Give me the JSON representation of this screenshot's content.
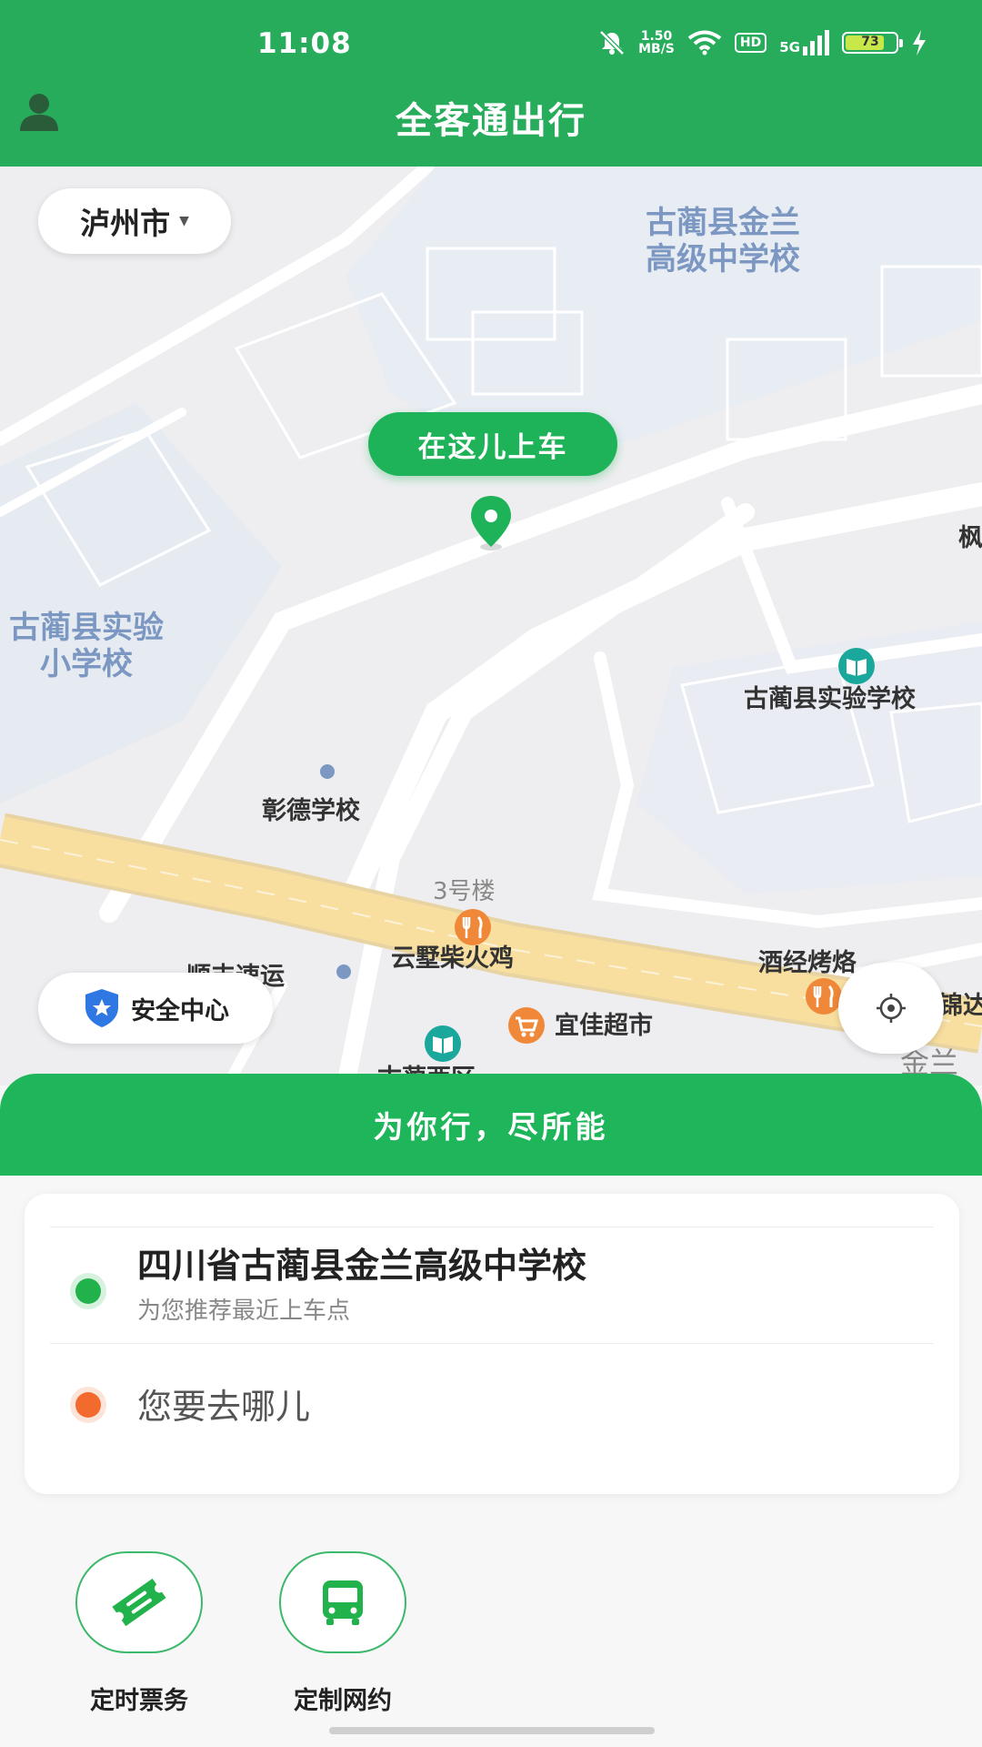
{
  "status_bar": {
    "time": "11:08",
    "speed_value": "1.50",
    "speed_unit": "MB/S",
    "hd_label": "HD",
    "network_label": "5G",
    "battery_level": "73",
    "icons": [
      "mute-icon",
      "wifi-icon",
      "signal-icon",
      "battery-icon",
      "charging-icon"
    ]
  },
  "header": {
    "title": "全客通出行",
    "profile_icon": "person-icon"
  },
  "city_selector": {
    "city": "泸州市"
  },
  "map": {
    "pickup_tag": "在这儿上车",
    "labels": {
      "school_top_line1": "古蔺县金兰",
      "school_top_line2": "高级中学校",
      "primary_line1": "古蔺县实验",
      "primary_line2": "小学校",
      "experimental_school": "古蔺县实验学校",
      "zhangde": "彰德学校",
      "building3": "3号楼",
      "yunshu": "云墅柴火鸡",
      "jiujing": "酒经烤烙",
      "shunda": "顺丰速运",
      "yijia": "宜佳超市",
      "gulan_west": "古蔺西区",
      "edge_right_top": "枫",
      "edge_right_mid": "锦达",
      "road_right": "金兰"
    }
  },
  "safety_center": {
    "label": "安全中心"
  },
  "slogan": "为你行，尽所能",
  "trip": {
    "from_title": "四川省古蔺县金兰高级中学校",
    "from_subtitle": "为您推荐最近上车点",
    "to_placeholder": "您要去哪儿",
    "from_color": "#22b24c",
    "to_color": "#f26a2e"
  },
  "services": [
    {
      "label": "定时票务",
      "icon": "ticket-icon"
    },
    {
      "label": "定制网约",
      "icon": "bus-icon"
    }
  ],
  "colors": {
    "brand_green": "#27ac5b",
    "slogan_green": "#1fb55a",
    "poi_orange": "#f0883a",
    "poi_teal": "#1aa79c",
    "road_yellow": "#f8dfa0"
  }
}
